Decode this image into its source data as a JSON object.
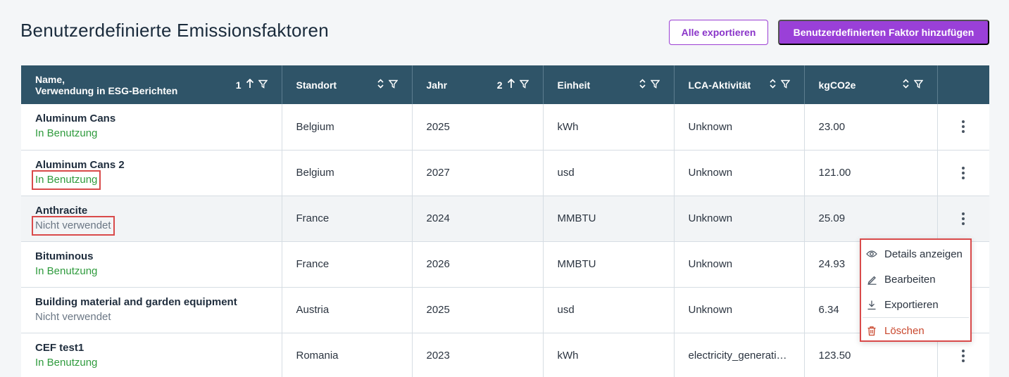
{
  "header": {
    "title": "Benutzerdefinierte Emissionsfaktoren",
    "export_all_label": "Alle exportieren",
    "add_custom_label": "Benutzerdefinierten Faktor hinzufügen"
  },
  "table": {
    "columns": [
      {
        "label_line1": "Name,",
        "label_line2": "Verwendung in ESG-Berichten",
        "sort_index": "1"
      },
      {
        "label": "Standort"
      },
      {
        "label": "Jahr",
        "sort_index": "2"
      },
      {
        "label": "Einheit"
      },
      {
        "label": "LCA-Aktivität"
      },
      {
        "label": "kgCO2e"
      }
    ],
    "rows": [
      {
        "name": "Aluminum Cans",
        "status": "In Benutzung",
        "location": "Belgium",
        "year": "2025",
        "unit": "kWh",
        "lca": "Unknown",
        "kgco2e": "23.00"
      },
      {
        "name": "Aluminum Cans 2",
        "status": "In Benutzung",
        "location": "Belgium",
        "year": "2027",
        "unit": "usd",
        "lca": "Unknown",
        "kgco2e": "121.00"
      },
      {
        "name": "Anthracite",
        "status": "Nicht verwendet",
        "location": "France",
        "year": "2024",
        "unit": "MMBTU",
        "lca": "Unknown",
        "kgco2e": "25.09"
      },
      {
        "name": "Bituminous",
        "status": "In Benutzung",
        "location": "France",
        "year": "2026",
        "unit": "MMBTU",
        "lca": "Unknown",
        "kgco2e": "24.93"
      },
      {
        "name": "Building material and garden equipment",
        "status": "Nicht verwendet",
        "location": "Austria",
        "year": "2025",
        "unit": "usd",
        "lca": "Unknown",
        "kgco2e": "6.34"
      },
      {
        "name": "CEF test1",
        "status": "In Benutzung",
        "location": "Romania",
        "year": "2023",
        "unit": "kWh",
        "lca": "electricity_generati…",
        "kgco2e": "123.50"
      }
    ]
  },
  "context_menu": {
    "items": [
      {
        "label": "Details anzeigen",
        "icon": "eye-icon"
      },
      {
        "label": "Bearbeiten",
        "icon": "pencil-icon"
      },
      {
        "label": "Exportieren",
        "icon": "download-icon"
      },
      {
        "label": "Löschen",
        "icon": "trash-icon"
      }
    ]
  },
  "colors": {
    "accent": "#9a40d8",
    "header_bg": "#2f5468",
    "status_used": "#2f9b3d",
    "status_unused": "#6b7785",
    "danger": "#c9482e",
    "highlight": "#d94a4a"
  }
}
